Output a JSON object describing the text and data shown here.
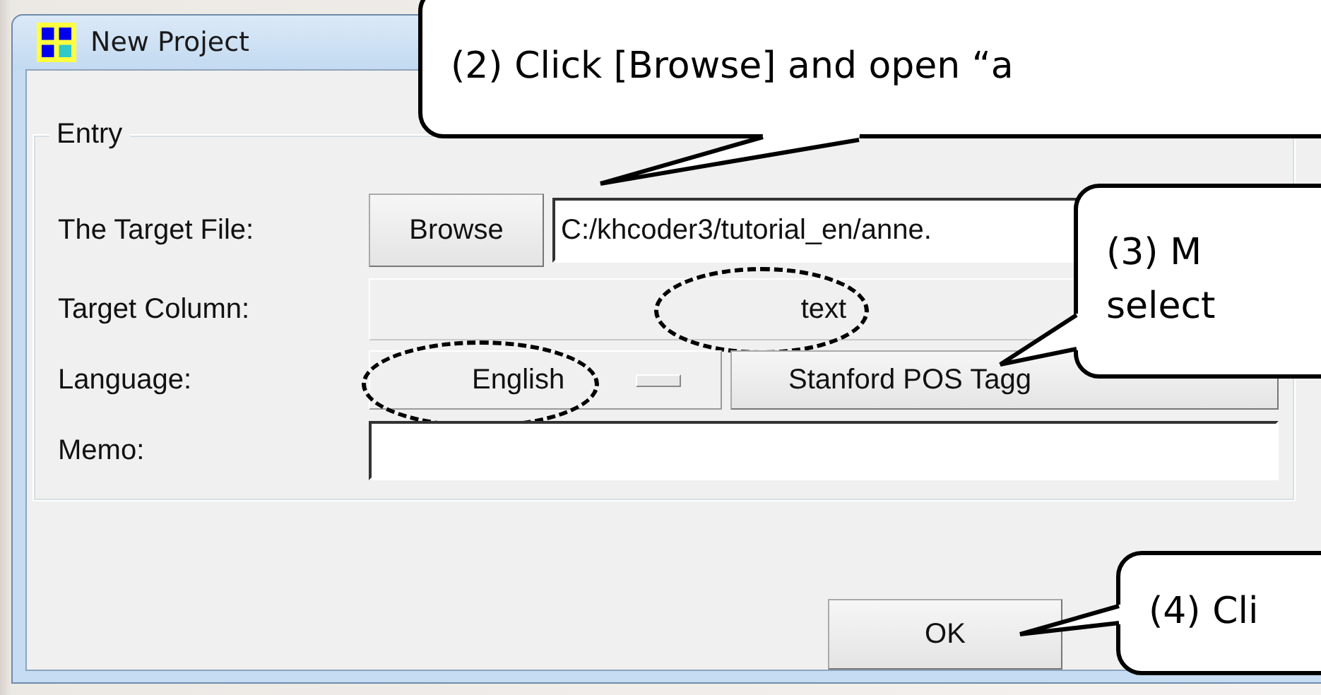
{
  "window": {
    "title": "New Project"
  },
  "group": {
    "label": "Entry"
  },
  "fields": [
    {
      "kind": "file",
      "label": "The Target File:",
      "button": "Browse",
      "value": "C:/khcoder3/tutorial_en/anne."
    },
    {
      "kind": "choice",
      "label": "Target Column:",
      "value": "text",
      "circled": true
    },
    {
      "kind": "language",
      "label": "Language:",
      "value": "English",
      "circled": true,
      "tagger": "Stanford POS Tagg"
    },
    {
      "kind": "memo",
      "label": "Memo:"
    }
  ],
  "buttons": [
    {
      "label": "OK"
    }
  ],
  "callouts": [
    {
      "lines": [
        "(2) Click [Browse] and open “a"
      ]
    },
    {
      "lines": [
        "(3) M",
        "select"
      ]
    },
    {
      "lines": [
        "(4) Cli"
      ]
    }
  ]
}
